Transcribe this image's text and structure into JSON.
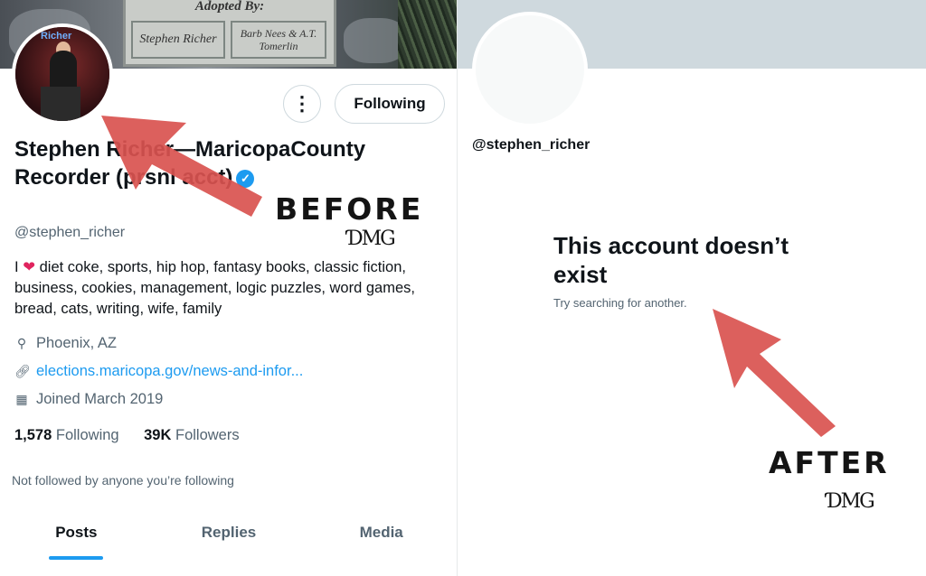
{
  "before": {
    "banner": {
      "plaque_header": "Adopted  By:",
      "plaque_left": "Stephen Richer",
      "plaque_right": "Barb Nees & A.T. Tomerlin"
    },
    "avatar": {
      "overlay_text": "Richer"
    },
    "buttons": {
      "more_icon": "⋮",
      "following": "Following"
    },
    "name": "Stephen Richer—MaricopaCounty Recorder (prsnl acct)",
    "verified_icon": "✓",
    "handle": "@stephen_richer",
    "bio_prefix": "I",
    "bio_heart": "❤",
    "bio_text": "diet coke, sports, hip hop, fantasy books, classic fiction, business, cookies, management, logic puzzles, word games, bread, cats, writing, wife, family",
    "location": "Phoenix, AZ",
    "website": "elections.maricopa.gov/news-and-infor...",
    "joined": "Joined March 2019",
    "following_count": "1,578",
    "following_label": "Following",
    "followers_count": "39K",
    "followers_label": "Followers",
    "not_followed": "Not followed by anyone you’re following",
    "tabs": [
      "Posts",
      "Replies",
      "Media"
    ],
    "active_tab": "Posts",
    "label": "BEFORE",
    "watermark": "ƊMG"
  },
  "after": {
    "handle": "@stephen_richer",
    "title": "This account doesn’t exist",
    "subtitle": "Try searching for another.",
    "label": "AFTER",
    "watermark": "ƊMG"
  },
  "colors": {
    "accent": "#1d9bf0",
    "arrow": "#d9534f",
    "secondary_text": "#536471"
  },
  "icons": {
    "location": "location-pin-icon",
    "link": "link-icon",
    "calendar": "calendar-icon",
    "more": "more-vertical-icon",
    "verified": "verified-badge-icon"
  }
}
